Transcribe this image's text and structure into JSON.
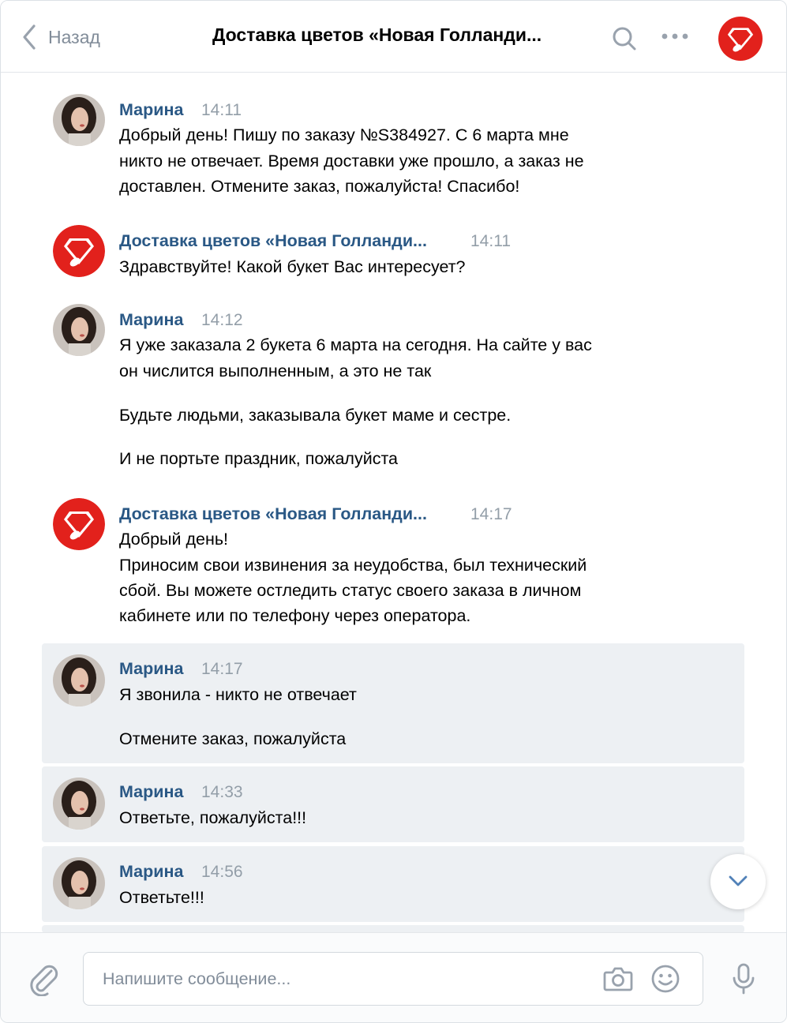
{
  "header": {
    "back_label": "Назад",
    "title": "Доставка цветов «Новая Голланди..."
  },
  "messages": [
    {
      "author": "Марина",
      "time": "14:11",
      "avatar": "user-photo",
      "lines": [
        "Добрый день! Пишу по заказу №S384927. С 6 марта мне",
        "никто не отвечает. Время доставки уже прошло, а заказ не",
        "доставлен. Отмените заказ, пожалуйста! Спасибо!"
      ]
    },
    {
      "author": "Доставка цветов «Новая Голланди...",
      "time": "14:11",
      "avatar": "brand-logo",
      "lines": [
        "Здравствуйте! Какой букет Вас интересует?"
      ]
    },
    {
      "author": "Марина",
      "time": "14:12",
      "avatar": "user-photo",
      "lines": [
        "Я уже заказала 2 букета 6 марта на сегодня. На сайте у вас",
        "он числится выполненным, а это не так",
        "Будьте людьми, заказывала букет маме и сестре.",
        "И не портьте праздник, пожалуйста"
      ]
    },
    {
      "author": "Доставка цветов «Новая Голланди...",
      "time": "14:17",
      "avatar": "brand-logo",
      "lines": [
        "Добрый день!",
        "Приносим свои извинения за неудобства, был технический",
        "сбой. Вы можете остледить статус своего заказа в личном",
        "кабинете или по телефону через оператора."
      ]
    },
    {
      "author": "Марина",
      "time": "14:17",
      "avatar": "user-photo",
      "selected": true,
      "lines": [
        "Я звонила - никто не отвечает",
        "Отмените заказ, пожалуйста"
      ]
    },
    {
      "author": "Марина",
      "time": "14:33",
      "avatar": "user-photo",
      "selected": true,
      "lines": [
        "Ответьте, пожалуйста!!!"
      ]
    },
    {
      "author": "Марина",
      "time": "14:56",
      "avatar": "user-photo",
      "selected": true,
      "lines": [
        "Ответьте!!!"
      ]
    }
  ],
  "composer": {
    "placeholder": "Напишите сообщение...",
    "value": ""
  },
  "icons": [
    "chevron-left-icon",
    "search-icon",
    "more-icon",
    "brand-logo-icon",
    "chevron-down-icon",
    "paperclip-icon",
    "camera-icon",
    "smile-icon",
    "microphone-icon"
  ],
  "colors": {
    "link": "#2a5885",
    "muted": "#939ea8",
    "selected_bg": "#edf0f3",
    "brand_red": "#e2211c"
  }
}
